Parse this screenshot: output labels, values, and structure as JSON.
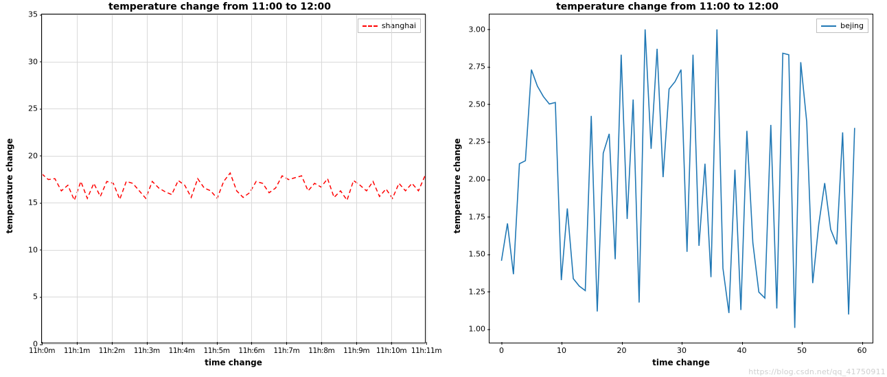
{
  "watermark": "https://blog.csdn.net/qq_41750911",
  "left": {
    "title": "temperature change from 11:00 to 12:00",
    "xlabel": "time change",
    "ylabel": "temperature change",
    "legend_label": "shanghai",
    "xticks": [
      "11h:0m",
      "11h:1m",
      "11h:2m",
      "11h:3m",
      "11h:4m",
      "11h:5m",
      "11h:6m",
      "11h:7m",
      "11h:8m",
      "11h:9m",
      "11h:10m",
      "11h:11m"
    ],
    "yticks": [
      0,
      5,
      10,
      15,
      20,
      25,
      30,
      35
    ]
  },
  "right": {
    "title": "temperature change from 11:00 to 12:00",
    "xlabel": "time change",
    "ylabel": "temperature change",
    "legend_label": "bejing",
    "xticks": [
      0,
      10,
      20,
      30,
      40,
      50,
      60
    ],
    "yticks": [
      1.0,
      1.25,
      1.5,
      1.75,
      2.0,
      2.25,
      2.5,
      2.75,
      3.0
    ]
  },
  "chart_data": [
    {
      "type": "line",
      "title": "temperature change from 11:00 to 12:00",
      "xlabel": "time change",
      "ylabel": "temperature change",
      "xlim": [
        0,
        59
      ],
      "ylim": [
        0,
        35
      ],
      "grid": true,
      "line_style": "dashed",
      "color": "#ff0000",
      "series": [
        {
          "name": "shanghai",
          "x": [
            0,
            1,
            2,
            3,
            4,
            5,
            6,
            7,
            8,
            9,
            10,
            11,
            12,
            13,
            14,
            15,
            16,
            17,
            18,
            19,
            20,
            21,
            22,
            23,
            24,
            25,
            26,
            27,
            28,
            29,
            30,
            31,
            32,
            33,
            34,
            35,
            36,
            37,
            38,
            39,
            40,
            41,
            42,
            43,
            44,
            45,
            46,
            47,
            48,
            49,
            50,
            51,
            52,
            53,
            54,
            55,
            56,
            57,
            58,
            59
          ],
          "values": [
            18.0,
            17.4,
            17.5,
            16.2,
            16.8,
            15.2,
            17.2,
            15.4,
            17.0,
            15.6,
            17.2,
            17.0,
            15.3,
            17.2,
            17.0,
            16.2,
            15.4,
            17.2,
            16.5,
            16.1,
            15.8,
            17.3,
            16.8,
            15.5,
            17.5,
            16.5,
            16.2,
            15.4,
            17.2,
            18.1,
            16.2,
            15.5,
            16.0,
            17.2,
            17.0,
            16.0,
            16.5,
            17.8,
            17.4,
            17.6,
            17.8,
            16.2,
            17.0,
            16.6,
            17.5,
            15.5,
            16.2,
            15.2,
            17.3,
            16.8,
            16.2,
            17.2,
            15.6,
            16.4,
            15.4,
            17.0,
            16.2,
            17.0,
            16.2,
            17.8
          ]
        }
      ],
      "x_tick_labels": [
        "11h:0m",
        "11h:1m",
        "11h:2m",
        "11h:3m",
        "11h:4m",
        "11h:5m",
        "11h:6m",
        "11h:7m",
        "11h:8m",
        "11h:9m",
        "11h:10m",
        "11h:11m"
      ]
    },
    {
      "type": "line",
      "title": "temperature change from 11:00 to 12:00",
      "xlabel": "time change",
      "ylabel": "temperature change",
      "xlim": [
        -2,
        62
      ],
      "ylim": [
        0.9,
        3.1
      ],
      "grid": false,
      "line_style": "solid",
      "color": "#1f77b4",
      "series": [
        {
          "name": "bejing",
          "x": [
            0,
            1,
            2,
            3,
            4,
            5,
            6,
            7,
            8,
            9,
            10,
            11,
            12,
            13,
            14,
            15,
            16,
            17,
            18,
            19,
            20,
            21,
            22,
            23,
            24,
            25,
            26,
            27,
            28,
            29,
            30,
            31,
            32,
            33,
            34,
            35,
            36,
            37,
            38,
            39,
            40,
            41,
            42,
            43,
            44,
            45,
            46,
            47,
            48,
            49,
            50,
            51,
            52,
            53,
            54,
            55,
            56,
            57,
            58,
            59
          ],
          "values": [
            1.45,
            1.7,
            1.36,
            2.1,
            2.12,
            2.73,
            2.62,
            2.55,
            2.5,
            2.51,
            1.32,
            1.8,
            1.33,
            1.28,
            1.25,
            2.42,
            1.11,
            2.17,
            2.3,
            1.46,
            2.83,
            1.73,
            2.53,
            1.17,
            3.0,
            2.2,
            2.87,
            2.01,
            2.6,
            2.65,
            2.73,
            1.51,
            2.83,
            1.55,
            2.1,
            1.34,
            3.0,
            1.4,
            1.1,
            2.06,
            1.12,
            2.32,
            1.57,
            1.24,
            1.2,
            2.36,
            1.13,
            2.84,
            2.83,
            1.0,
            2.78,
            2.38,
            1.3,
            1.69,
            1.97,
            1.66,
            1.56,
            2.31,
            1.09,
            2.34
          ]
        }
      ]
    }
  ]
}
